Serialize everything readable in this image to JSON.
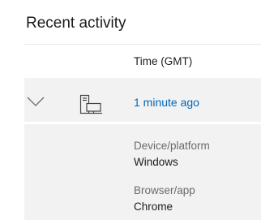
{
  "section": {
    "title": "Recent activity"
  },
  "table": {
    "columns": [
      "Time (GMT)"
    ]
  },
  "activity": {
    "expanded": true,
    "device_icon": "device-desktop-icon",
    "time": "1 minute ago",
    "details": [
      {
        "label": "Device/platform",
        "value": "Windows"
      },
      {
        "label": "Browser/app",
        "value": "Chrome"
      }
    ]
  },
  "colors": {
    "link": "#0067b8",
    "row_background": "#f2f2f2",
    "label": "#6b6b6b",
    "text": "#1b1b1b"
  }
}
